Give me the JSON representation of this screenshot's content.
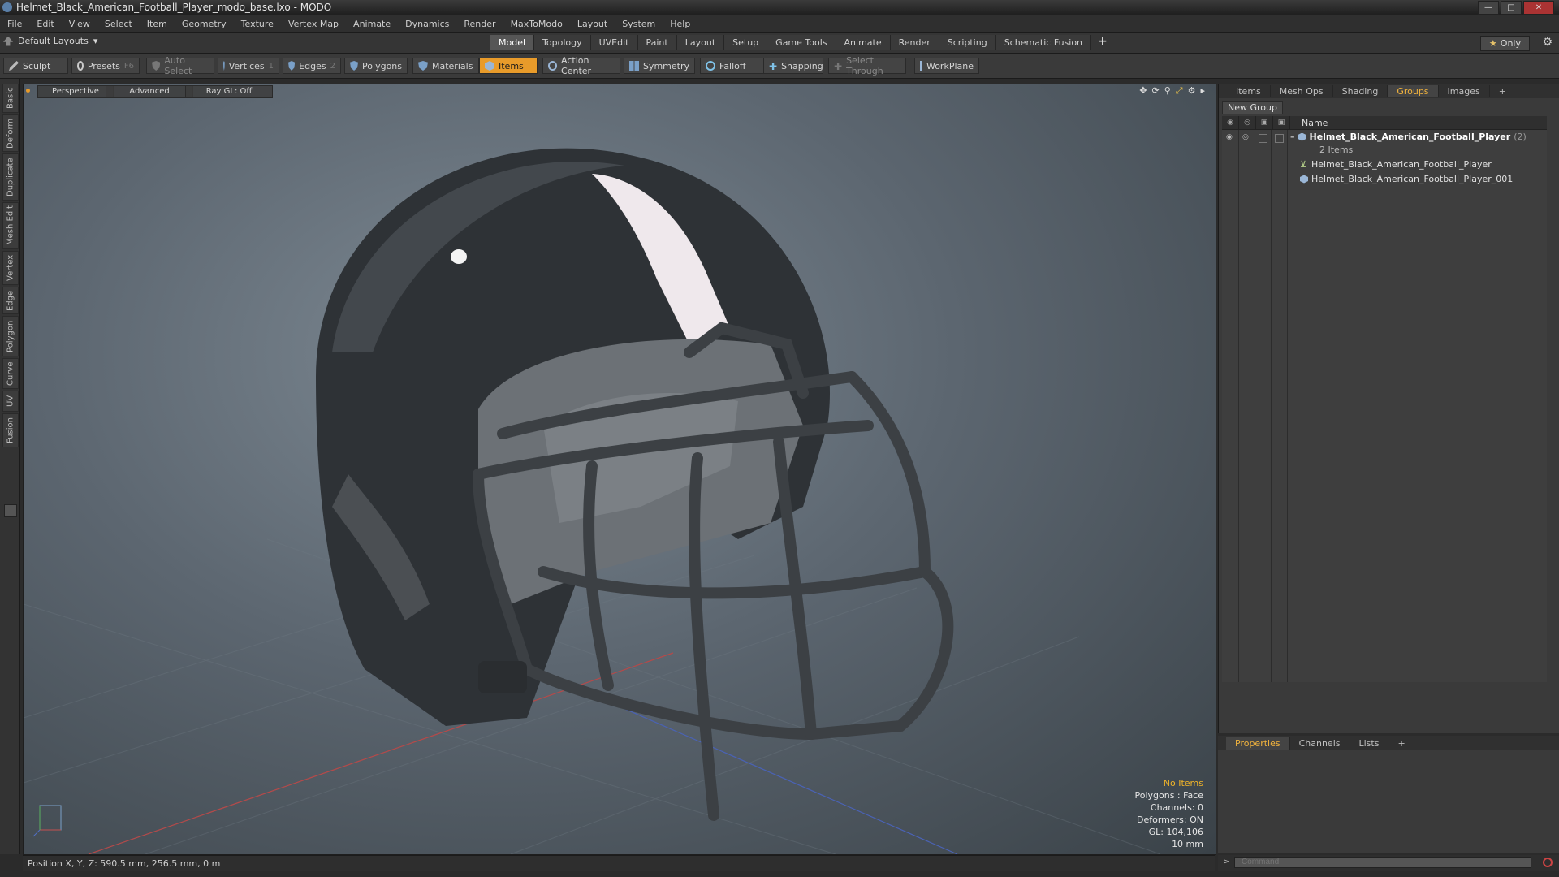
{
  "window": {
    "title": "Helmet_Black_American_Football_Player_modo_base.lxo - MODO"
  },
  "menu": [
    "File",
    "Edit",
    "View",
    "Select",
    "Item",
    "Geometry",
    "Texture",
    "Vertex Map",
    "Animate",
    "Dynamics",
    "Render",
    "MaxToModo",
    "Layout",
    "System",
    "Help"
  ],
  "layouts": {
    "label": "Default Layouts"
  },
  "mode_tabs": [
    {
      "label": "Model",
      "active": true
    },
    {
      "label": "Topology"
    },
    {
      "label": "UVEdit"
    },
    {
      "label": "Paint"
    },
    {
      "label": "Layout"
    },
    {
      "label": "Setup"
    },
    {
      "label": "Game Tools"
    },
    {
      "label": "Animate"
    },
    {
      "label": "Render"
    },
    {
      "label": "Scripting"
    },
    {
      "label": "Schematic Fusion"
    }
  ],
  "only_label": "Only",
  "toolbar": {
    "sculpt": "Sculpt",
    "presets": "Presets",
    "presets_key": "F6",
    "auto_select": "Auto Select",
    "vertices": "Vertices",
    "vertices_key": "1",
    "edges": "Edges",
    "edges_key": "2",
    "polygons": "Polygons",
    "materials": "Materials",
    "items": "Items",
    "action_center": "Action Center",
    "symmetry": "Symmetry",
    "falloff": "Falloff",
    "snapping": "Snapping",
    "select_through": "Select Through",
    "workplane": "WorkPlane"
  },
  "left_tabs": [
    "Basic",
    "Deform",
    "Duplicate",
    "Mesh Edit",
    "Vertex",
    "Edge",
    "Polygon",
    "Curve",
    "UV",
    "Fusion"
  ],
  "viewport": {
    "view": "Perspective",
    "shading": "Advanced",
    "raygl": "Ray GL: Off",
    "info": {
      "selection": "No Items",
      "polygons": "Polygons : Face",
      "channels": "Channels: 0",
      "deformers": "Deformers: ON",
      "gl": "GL: 104,106",
      "scale": "10 mm"
    }
  },
  "status": {
    "position": "Position X, Y, Z:  590.5 mm, 256.5 mm, 0 m"
  },
  "right_panel": {
    "tabs": [
      {
        "label": "Items"
      },
      {
        "label": "Mesh Ops"
      },
      {
        "label": "Shading"
      },
      {
        "label": "Groups",
        "active": true
      },
      {
        "label": "Images"
      }
    ],
    "new_group": "New Group",
    "name_header": "Name",
    "group": {
      "name": "Helmet_Black_American_Football_Player",
      "count": "(2)",
      "subtitle": "2 Items",
      "children": [
        "Helmet_Black_American_Football_Player",
        "Helmet_Black_American_Football_Player_001"
      ]
    }
  },
  "props_tabs": [
    {
      "label": "Properties",
      "active": true
    },
    {
      "label": "Channels"
    },
    {
      "label": "Lists"
    }
  ],
  "command": {
    "placeholder": "Command"
  },
  "colors": {
    "accent": "#e89b2a",
    "active_tab_text": "#f2b33d",
    "info_warn": "#f0b429"
  }
}
